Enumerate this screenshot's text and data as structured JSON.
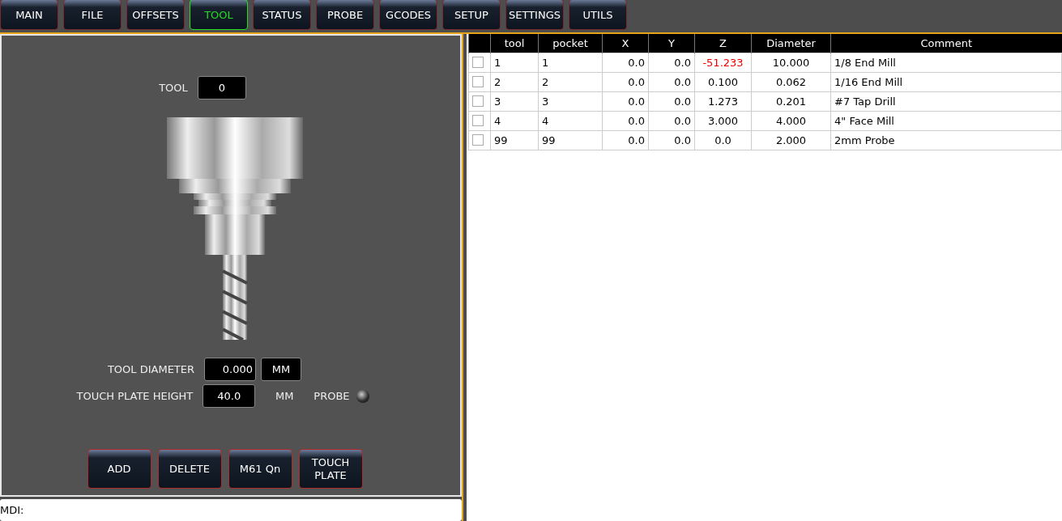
{
  "tabs": [
    {
      "label": "MAIN",
      "selected": false
    },
    {
      "label": "FILE",
      "selected": false
    },
    {
      "label": "OFFSETS",
      "selected": false
    },
    {
      "label": "TOOL",
      "selected": true
    },
    {
      "label": "STATUS",
      "selected": false
    },
    {
      "label": "PROBE",
      "selected": false
    },
    {
      "label": "GCODES",
      "selected": false
    },
    {
      "label": "SETUP",
      "selected": false
    },
    {
      "label": "SETTINGS",
      "selected": false
    },
    {
      "label": "UTILS",
      "selected": false
    }
  ],
  "tool_panel": {
    "tool_label": "TOOL",
    "tool_value": "0",
    "diameter_label": "TOOL DIAMETER",
    "diameter_value": "0.000",
    "diameter_unit": "MM",
    "plate_label": "TOUCH PLATE HEIGHT",
    "plate_value": "40.0",
    "plate_unit": "MM",
    "probe_label": "PROBE",
    "probe_on": false,
    "buttons": [
      "ADD",
      "DELETE",
      "M61 Qn",
      "TOUCH\nPLATE"
    ]
  },
  "mdi": {
    "label": "MDI:"
  },
  "table": {
    "columns": [
      "tool",
      "pocket",
      "X",
      "Y",
      "Z",
      "Diameter",
      "Comment"
    ],
    "rows": [
      {
        "checked": false,
        "cells": [
          "1",
          "1",
          "0.0",
          "0.0",
          "-51.233",
          "10.000",
          "1/8 End Mill"
        ],
        "z_alert": true
      },
      {
        "checked": false,
        "cells": [
          "2",
          "2",
          "0.0",
          "0.0",
          "0.100",
          "0.062",
          "1/16 End Mill"
        ],
        "z_alert": false
      },
      {
        "checked": false,
        "cells": [
          "3",
          "3",
          "0.0",
          "0.0",
          "1.273",
          "0.201",
          "#7 Tap Drill"
        ],
        "z_alert": false
      },
      {
        "checked": false,
        "cells": [
          "4",
          "4",
          "0.0",
          "0.0",
          "3.000",
          "4.000",
          "4\" Face Mill"
        ],
        "z_alert": false
      },
      {
        "checked": false,
        "cells": [
          "99",
          "99",
          "0.0",
          "0.0",
          "0.0",
          "2.000",
          "2mm Probe"
        ],
        "z_alert": false
      }
    ]
  }
}
